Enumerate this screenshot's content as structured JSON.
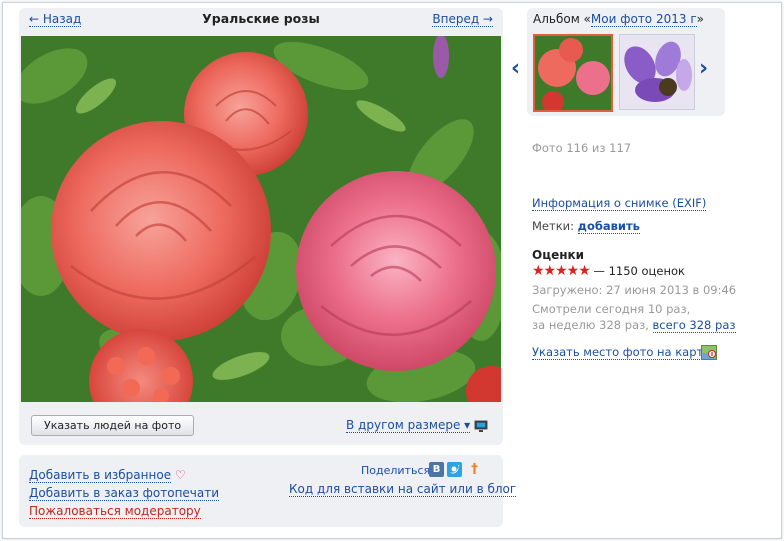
{
  "nav": {
    "back": "← Назад",
    "title": "Уральские розы",
    "next": "Вперед →"
  },
  "buttons": {
    "tag_people": "Указать людей на фото",
    "other_size": "В другом размере ▾"
  },
  "album": {
    "prefix": "Альбом «",
    "name": "Мои фото 2013 г",
    "suffix": "»",
    "left_arrow": "‹",
    "right_arrow": "›"
  },
  "info": {
    "photo_count": "Фото 116 из 117",
    "exif_link": "Информация о снимке (EXIF)",
    "tags_label": "Метки:",
    "tags_add": "добавить",
    "rating_title": "Оценки",
    "stars": "★★★★★",
    "rating_count": "— 1150 оценок",
    "uploaded": "Загружено: 27 июня 2013 в 09:46",
    "views_line1": "Смотрели сегодня 10 раз,",
    "views_line2_prefix": "за неделю 328 раз,",
    "views_total": "всего 328 раз",
    "map_link": "Указать место фото на карте"
  },
  "actions": {
    "favorite": "Добавить в избранное",
    "print": "Добавить в заказ фотопечати",
    "report": "Пожаловаться модератору",
    "share": "Поделиться",
    "embed": "Код для вставки на сайт или в блог",
    "vk": "B",
    "ok": "†"
  },
  "icons": {
    "heart": "heart-icon",
    "monitor": "monitor-icon",
    "map": "map-pin-icon",
    "vk": "vk-icon",
    "twitter": "twitter-icon",
    "odnoklassniki": "odnoklassniki-icon"
  },
  "colors": {
    "link": "#1a4fa0",
    "panel": "#eef0f3",
    "stars": "#e02020",
    "report": "#c0271e"
  }
}
